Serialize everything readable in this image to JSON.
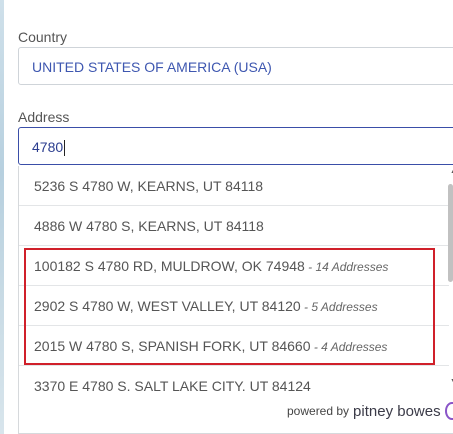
{
  "country": {
    "label": "Country",
    "value": "UNITED STATES OF AMERICA (USA)"
  },
  "address": {
    "label": "Address",
    "value": "4780"
  },
  "suggestions": [
    {
      "text": "5236 S 4780 W, KEARNS, UT 84118",
      "count": ""
    },
    {
      "text": "4886 W 4780 S, KEARNS, UT 84118",
      "count": ""
    },
    {
      "text": "100182 S 4780 RD, MULDROW, OK 74948",
      "count": " - 14 Addresses"
    },
    {
      "text": "2902 S 4780 W, WEST VALLEY, UT 84120",
      "count": " - 5 Addresses"
    },
    {
      "text": "2015 W 4780 S, SPANISH FORK, UT 84660",
      "count": " - 4 Addresses"
    },
    {
      "text": "3370 E 4780 S. SALT LAKE CITY. UT 84124",
      "count": ""
    }
  ],
  "footer": {
    "powered_by": "powered by",
    "brand": "pitney bowes"
  },
  "colors": {
    "highlight": "#d0202a",
    "accent": "#3a4ea8",
    "brand": "#8a55c8"
  }
}
